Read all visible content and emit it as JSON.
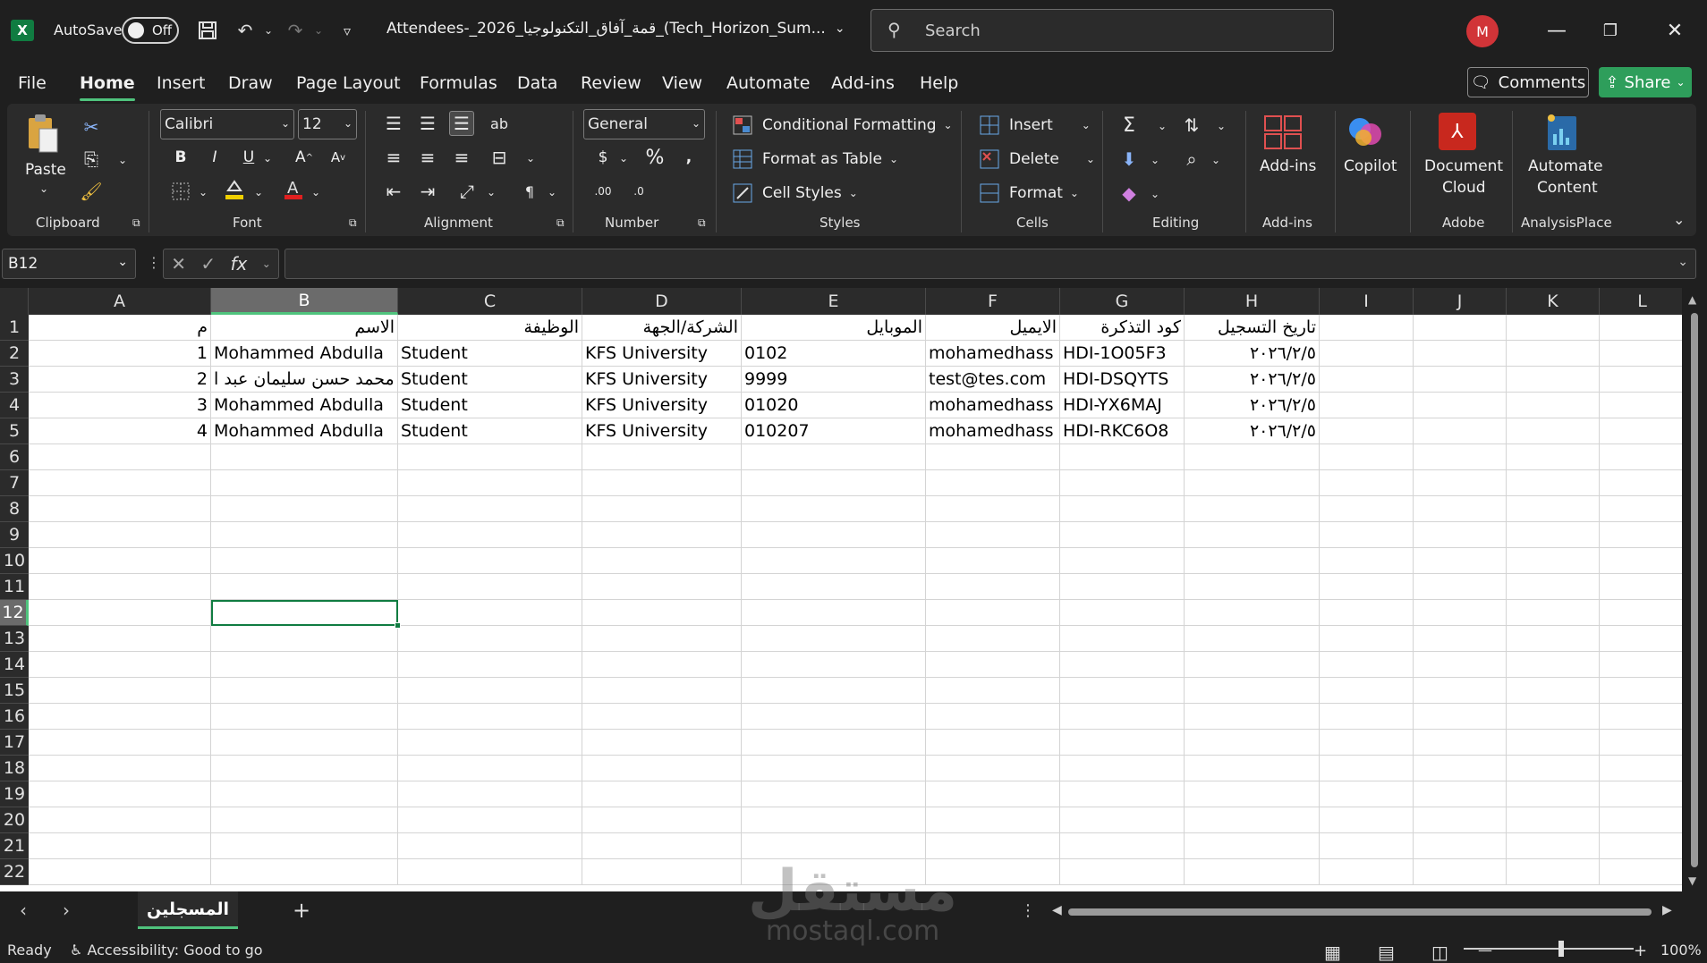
{
  "title_bar": {
    "app_icon": "excel-icon",
    "autosave_label": "AutoSave",
    "autosave_state": "Off",
    "filename": "Attendees-_2026_قمة_آفاق_التكنولوجيا_(Tech_Horizon_Sum...",
    "search_placeholder": "Search",
    "avatar_initial": "M"
  },
  "menu": {
    "tabs": [
      "File",
      "Home",
      "Insert",
      "Draw",
      "Page Layout",
      "Formulas",
      "Data",
      "Review",
      "View",
      "Automate",
      "Add-ins",
      "Help"
    ],
    "active_tab": "Home",
    "comments_label": "Comments",
    "share_label": "Share"
  },
  "ribbon": {
    "clipboard": {
      "paste": "Paste",
      "group": "Clipboard"
    },
    "font": {
      "name": "Calibri",
      "size": "12",
      "group": "Font"
    },
    "alignment": {
      "group": "Alignment"
    },
    "number": {
      "format": "General",
      "group": "Number"
    },
    "styles": {
      "conditional": "Conditional Formatting",
      "format_table": "Format as Table",
      "cell_styles": "Cell Styles",
      "group": "Styles"
    },
    "cells": {
      "insert": "Insert",
      "delete": "Delete",
      "format": "Format",
      "group": "Cells"
    },
    "editing": {
      "group": "Editing"
    },
    "addins": {
      "label": "Add-ins",
      "group": "Add-ins"
    },
    "copilot": {
      "label": "Copilot"
    },
    "adobe": {
      "label1": "Document",
      "label2": "Cloud",
      "group": "Adobe"
    },
    "analysis": {
      "label1": "Automate",
      "label2": "Content",
      "group": "AnalysisPlace"
    }
  },
  "formula_bar": {
    "name_box": "B12",
    "formula": ""
  },
  "grid": {
    "columns": [
      "A",
      "B",
      "C",
      "D",
      "E",
      "F",
      "G",
      "H",
      "I",
      "J",
      "K",
      "L"
    ],
    "rows": [
      "1",
      "2",
      "3",
      "4",
      "5",
      "6",
      "7",
      "8",
      "9",
      "10",
      "11",
      "12",
      "13",
      "14",
      "15",
      "16",
      "17",
      "18",
      "19",
      "20",
      "21",
      "22"
    ],
    "selected_cell": "B12",
    "data": [
      [
        "م",
        "الاسم",
        "الوظيفة",
        "الشركة/الجهة",
        "الموبايل",
        "الايميل",
        "كود التذكرة",
        "تاريخ التسجيل"
      ],
      [
        "1",
        "Mohammed Abdulla",
        "Student",
        "KFS University",
        "0102",
        "mohamedhass",
        "HDI-1O05F3",
        "٢٠٢٦/٢/٥"
      ],
      [
        "2",
        "محمد حسن سليمان عبد ا",
        "Student",
        "KFS University",
        "9999",
        "test@tes.com",
        "HDI-DSQYTS",
        "٢٠٢٦/٢/٥"
      ],
      [
        "3",
        "Mohammed Abdulla",
        "Student",
        "KFS University",
        "01020",
        "mohamedhass",
        "HDI-YX6MAJ",
        "٢٠٢٦/٢/٥"
      ],
      [
        "4",
        "Mohammed Abdulla",
        "Student",
        "KFS University",
        "010207",
        "mohamedhass",
        "HDI-RKC6O8",
        "٢٠٢٦/٢/٥"
      ]
    ]
  },
  "sheets": {
    "tabs": [
      "المسجلين"
    ],
    "active": "المسجلين"
  },
  "status": {
    "ready": "Ready",
    "accessibility": "Accessibility: Good to go",
    "zoom": "100%"
  },
  "watermark": {
    "arabic": "مستقل",
    "latin": "mostaql.com"
  }
}
